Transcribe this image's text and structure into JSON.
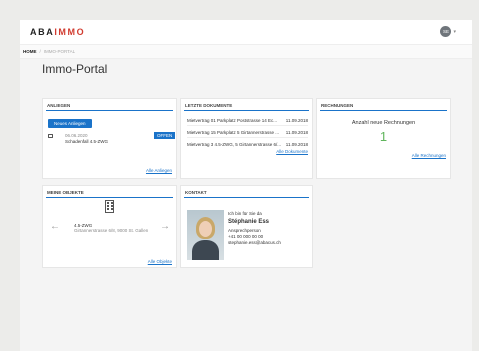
{
  "brand": {
    "part1": "ABA",
    "part2": "IMMO",
    "accent": "#d13b2f"
  },
  "user": {
    "initials": "SE",
    "caret": "▾"
  },
  "breadcrumb": {
    "home": "HOME",
    "separator": "/",
    "current": "IMMO-PORTAL"
  },
  "page": {
    "title": "Immo-Portal"
  },
  "anliegen": {
    "title": "ANLIEGEN",
    "new_button": "Neues Anliegen",
    "item": {
      "date": "06.06.2020",
      "title": "Schadenfall 4.5-ZWG",
      "status": "OFFEN"
    },
    "link": "Alle Anliegen"
  },
  "documents": {
    "title": "LETZTE DOKUMENTE",
    "items": [
      {
        "name": "Mietvertrag 01 Parkplatz Poststrasse 14 Ec...",
        "date": "11.09.2018"
      },
      {
        "name": "Mietvertrag 15 Parkplatz 5 Girtannerstrasse ...",
        "date": "11.09.2018"
      },
      {
        "name": "Mietvertrag 3 4.5-ZWG, 5 Girtannerstrasse 6/...",
        "date": "11.09.2018"
      }
    ],
    "link": "Alle Dokumente"
  },
  "invoices": {
    "title": "RECHNUNGEN",
    "label": "Anzahl neue Rechnungen",
    "count": "1",
    "link": "Alle Rechnungen"
  },
  "objects": {
    "title": "MEINE OBJEKTE",
    "item": {
      "name": "4.5-ZWG",
      "address": "Girtannerstrasse 6/8, 9000 St. Gallen"
    },
    "link": "Alle Objekte",
    "prev": "←",
    "next": "→"
  },
  "contact": {
    "title": "KONTAKT",
    "intro": "Ich bin für Sie da",
    "name": "Stéphanie Ess",
    "role": "Ansprechperson",
    "phone": "+41 00 000 00 00",
    "email": "stephanie.ess@abacus.ch"
  },
  "colors": {
    "primary": "#1a73c9",
    "success": "#5fb55c"
  }
}
